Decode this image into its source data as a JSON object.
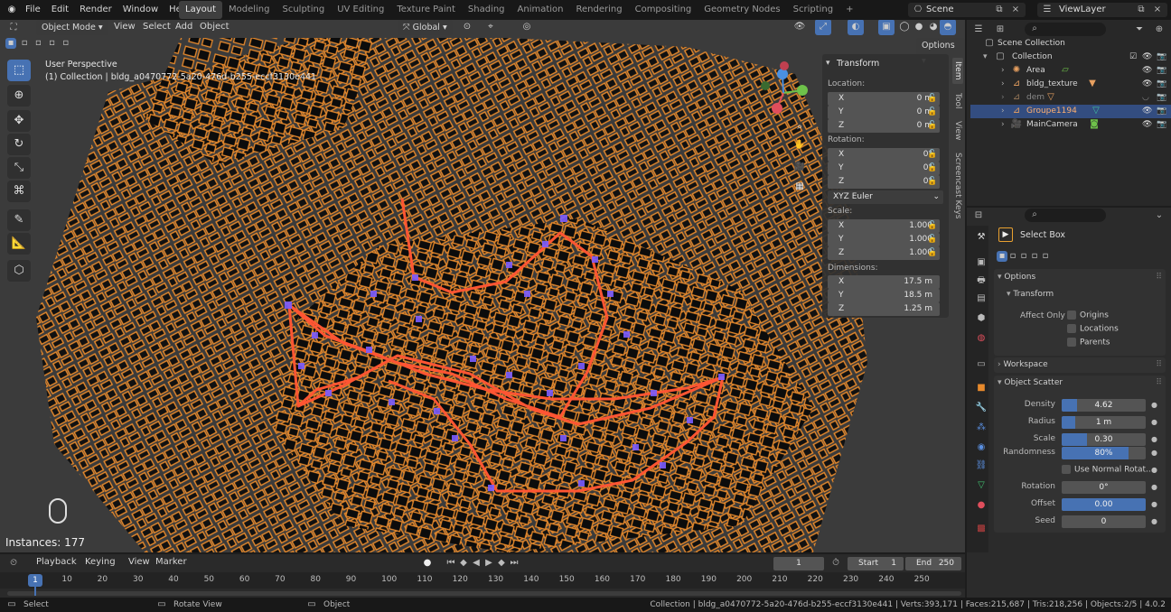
{
  "menubar": {
    "menus": [
      "File",
      "Edit",
      "Render",
      "Window",
      "Help"
    ],
    "workspaces": [
      "Layout",
      "Modeling",
      "Sculpting",
      "UV Editing",
      "Texture Paint",
      "Shading",
      "Animation",
      "Rendering",
      "Compositing",
      "Geometry Nodes",
      "Scripting"
    ],
    "active_workspace": "Layout",
    "scene": "Scene",
    "view_layer": "ViewLayer"
  },
  "viewport_header": {
    "mode": "Object Mode",
    "menus": [
      "View",
      "Select",
      "Add",
      "Object"
    ],
    "transform_orientation": "Global",
    "options_label": "Options"
  },
  "viewport": {
    "perspective": "User Perspective",
    "collection_info": "(1) Collection | bldg_a0470772-5a20-476d-b255-eccf3130e441",
    "instances": "Instances: 177",
    "side_tabs": [
      "Item",
      "Tool",
      "View",
      "Screencast Keys"
    ]
  },
  "npanel": {
    "title": "Transform",
    "location_label": "Location:",
    "location": [
      {
        "axis": "X",
        "value": "0 m"
      },
      {
        "axis": "Y",
        "value": "0 m"
      },
      {
        "axis": "Z",
        "value": "0 m"
      }
    ],
    "rotation_label": "Rotation:",
    "rotation": [
      {
        "axis": "X",
        "value": "0°"
      },
      {
        "axis": "Y",
        "value": "0°"
      },
      {
        "axis": "Z",
        "value": "0°"
      }
    ],
    "rotation_mode": "XYZ Euler",
    "scale_label": "Scale:",
    "scale": [
      {
        "axis": "X",
        "value": "1.000"
      },
      {
        "axis": "Y",
        "value": "1.000"
      },
      {
        "axis": "Z",
        "value": "1.000"
      }
    ],
    "dimensions_label": "Dimensions:",
    "dimensions": [
      {
        "axis": "X",
        "value": "17.5 m"
      },
      {
        "axis": "Y",
        "value": "18.5 m"
      },
      {
        "axis": "Z",
        "value": "1.25 m"
      }
    ]
  },
  "outliner": {
    "root": "Scene Collection",
    "collection": "Collection",
    "items": [
      {
        "name": "Area",
        "color": "#e8a060",
        "icon": "light-icon"
      },
      {
        "name": "bldg_texture",
        "color": "#e8a060",
        "icon": "mesh-icon"
      },
      {
        "name": "dem",
        "color": "#9a7a5a",
        "icon": "mesh-icon"
      },
      {
        "name": "Groupe1194",
        "color": "#e8a060",
        "icon": "mesh-icon"
      },
      {
        "name": "MainCamera",
        "color": "#e8a060",
        "icon": "camera-icon"
      }
    ]
  },
  "properties": {
    "tool_name": "Select Box",
    "options_header": "Options",
    "transform_header": "Transform",
    "affect_only_label": "Affect Only",
    "affect_only": [
      "Origins",
      "Locations",
      "Parents"
    ],
    "workspace_header": "Workspace",
    "scatter_header": "Object Scatter",
    "scatter": [
      {
        "label": "Density",
        "value": "4.62",
        "fill": 0.18
      },
      {
        "label": "Radius",
        "value": "1 m",
        "fill": 0.16
      },
      {
        "label": "Scale",
        "value": "0.30",
        "fill": 0.3
      },
      {
        "label": "Randomness",
        "value": "80%",
        "fill": 0.8
      }
    ],
    "use_normal_label": "Use Normal Rotat...",
    "rotation_label": "Rotation",
    "rotation_value": "0°",
    "offset_label": "Offset",
    "offset_value": "0.00",
    "seed_label": "Seed",
    "seed_value": "0"
  },
  "timeline": {
    "menus": [
      "Playback",
      "Keying",
      "View",
      "Marker"
    ],
    "current_frame": "1",
    "start_label": "Start",
    "start": "1",
    "end_label": "End",
    "end": "250",
    "ticks": [
      "1",
      "10",
      "20",
      "30",
      "40",
      "50",
      "60",
      "70",
      "80",
      "90",
      "100",
      "110",
      "120",
      "130",
      "140",
      "150",
      "160",
      "170",
      "180",
      "190",
      "200",
      "210",
      "220",
      "230",
      "240",
      "250"
    ]
  },
  "statusbar": {
    "select": "Select",
    "rotate": "Rotate View",
    "object": "Object",
    "info": "Collection | bldg_a0470772-5a20-476d-b255-eccf3130e441 | Verts:393,171 | Faces:215,687 | Tris:218,256 | Objects:2/5 | 4.0.2"
  },
  "colors": {
    "accent": "#4772b3",
    "building_outline": "#e88a2c",
    "path": "#ff5533",
    "points": "#7b5cff"
  }
}
